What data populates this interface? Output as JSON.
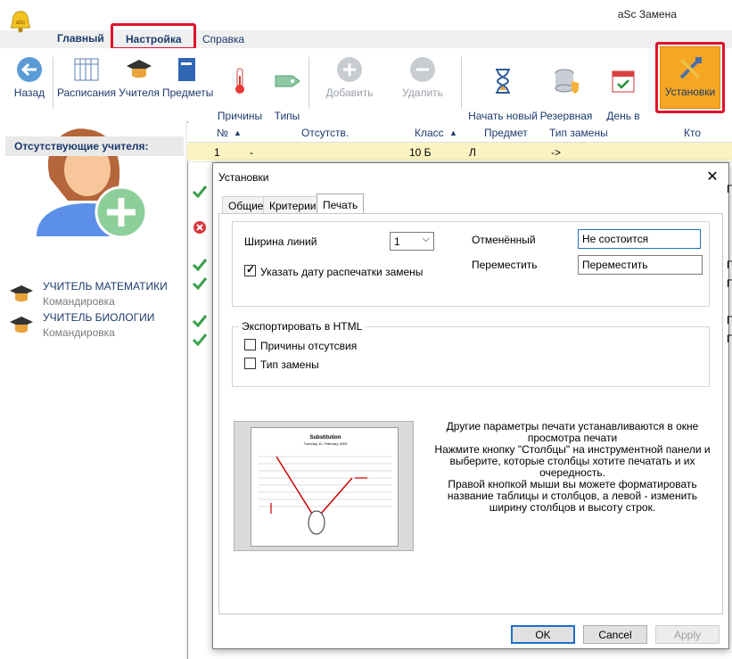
{
  "app": {
    "title": "aSc Замена"
  },
  "menu": {
    "tabs": [
      "Главный",
      "Настройка",
      "Справка"
    ]
  },
  "ribbon": {
    "buttons": [
      {
        "label": "Назад",
        "icon": "back-arrow-icon"
      },
      {
        "label": "Расписания",
        "icon": "timetable-icon"
      },
      {
        "label": "Учителя",
        "icon": "teacher-cap-icon"
      },
      {
        "label": "Предметы",
        "icon": "book-icon"
      },
      {
        "label": "Причины\nотсутствия",
        "icon": "thermometer-icon"
      },
      {
        "label": "Типы\nзамен",
        "icon": "tag-icon"
      },
      {
        "label": "Добавить",
        "icon": "plus-circle-icon",
        "disabled": true
      },
      {
        "label": "Удалить",
        "icon": "minus-circle-icon",
        "disabled": true
      },
      {
        "label": "Начать новый\nучебный год",
        "icon": "hourglass-icon"
      },
      {
        "label": "Резервная\nкопия",
        "icon": "database-shield-icon"
      },
      {
        "label": "День в\nрасписании",
        "icon": "calendar-check-icon"
      },
      {
        "label": "Установки",
        "icon": "tools-icon",
        "active": true
      }
    ]
  },
  "left_panel": {
    "absent_header": "Отсутствующие учителя:",
    "teachers": [
      {
        "name": "УЧИТЕЛЬ МАТЕМАТИКИ",
        "reason": "Командировка"
      },
      {
        "name": "УЧИТЕЛЬ БИОЛОГИИ",
        "reason": "Командировка"
      }
    ]
  },
  "table": {
    "columns": [
      "№",
      "Отсутств.",
      "Класс",
      "Предмет",
      "Тип замены",
      "Кто замен"
    ],
    "row1": {
      "num": "1",
      "absent": "-",
      "class": "10 Б",
      "subject": "Л",
      "type": "->"
    }
  },
  "dialog": {
    "title": "Установки",
    "tabs": [
      "Общие",
      "Критерии",
      "Печать"
    ],
    "active_tab": "Печать",
    "line_width_label": "Ширина линий",
    "line_width_value": "1",
    "print_date_label": "Указать дату распечатки замены",
    "print_date_checked": true,
    "cancelled_label": "Отменённый",
    "cancelled_value": "Не состоится",
    "move_label": "Переместить",
    "move_value": "Переместить",
    "export_group": "Экспортировать в HTML",
    "export_reasons": "Причины отсутсвия",
    "export_type": "Тип замены",
    "info_text": "Другие параметры печати устанавливаются в окне просмотра печати\nНажмите кнопку \"Столбцы\" на инструментной панели и выберите, которые столбцы хотите печатать и их очередность.\nПравой кнопкой мыши вы можете форматировать название таблицы и столбцов, а левой - изменить ширину столбцов и высоту строк.",
    "preview": {
      "title": "Substitution",
      "subtitle": "Tuesday 11. February 2003"
    },
    "ok": "OK",
    "cancel": "Cancel",
    "apply": "Apply"
  },
  "colors": {
    "accent": "#1e6fc8",
    "highlight": "#e0112b",
    "active_button": "#f5a623",
    "row_highlight": "#fbf4c2"
  }
}
